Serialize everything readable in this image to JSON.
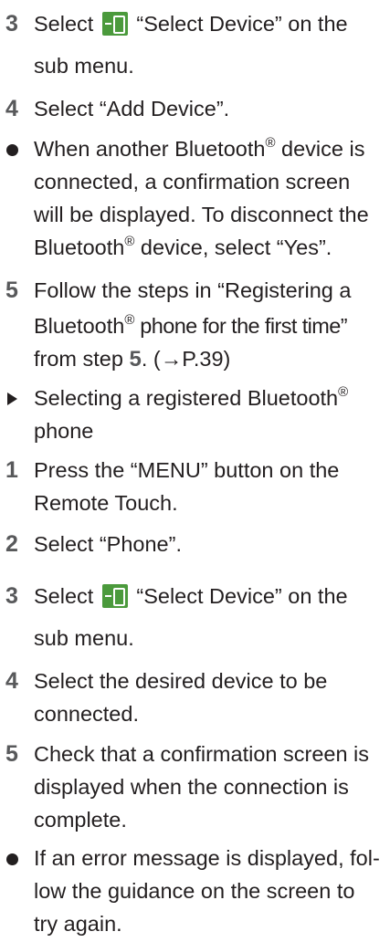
{
  "steps_a": [
    {
      "marker": "3",
      "lines": [
        "Select",
        "“Select Device” on the",
        "sub menu."
      ]
    },
    {
      "marker": "4",
      "lines": [
        "Select “Add Device”."
      ]
    }
  ],
  "note_a": {
    "lines": [
      "When another Bluetooth",
      "®",
      "device is",
      "connected, a confirmation screen",
      "will be displayed. To disconnect the",
      "Bluetooth",
      "®",
      "device, select “Yes”."
    ]
  },
  "step_5a": {
    "marker": "5",
    "lines": [
      "Follow the steps in “Registering a",
      "Bluetooth",
      "®",
      " phone for the first time”",
      "from step ",
      "5",
      ". (→P.39)"
    ]
  },
  "heading": {
    "lines": [
      "Selecting a registered Bluetooth",
      "®",
      "phone"
    ]
  },
  "steps_b": [
    {
      "marker": "1",
      "lines": [
        "Press the “MENU” button on the",
        "Remote Touch."
      ]
    },
    {
      "marker": "2",
      "lines": [
        "Select “Phone”."
      ]
    },
    {
      "marker": "3",
      "lines": [
        "Select",
        "“Select Device” on the",
        "sub menu."
      ]
    },
    {
      "marker": "4",
      "lines": [
        "Select the desired device to be",
        "connected."
      ]
    },
    {
      "marker": "5",
      "lines": [
        "Check that a confirmation screen is",
        "displayed when the connection is",
        "complete."
      ]
    }
  ],
  "note_b": {
    "lines": [
      "If an error message is displayed, fol-",
      "low the guidance on the screen to",
      "try again."
    ]
  },
  "icons": {
    "select_device": "phone-device-icon",
    "accent_color": "#4b9a3c"
  }
}
